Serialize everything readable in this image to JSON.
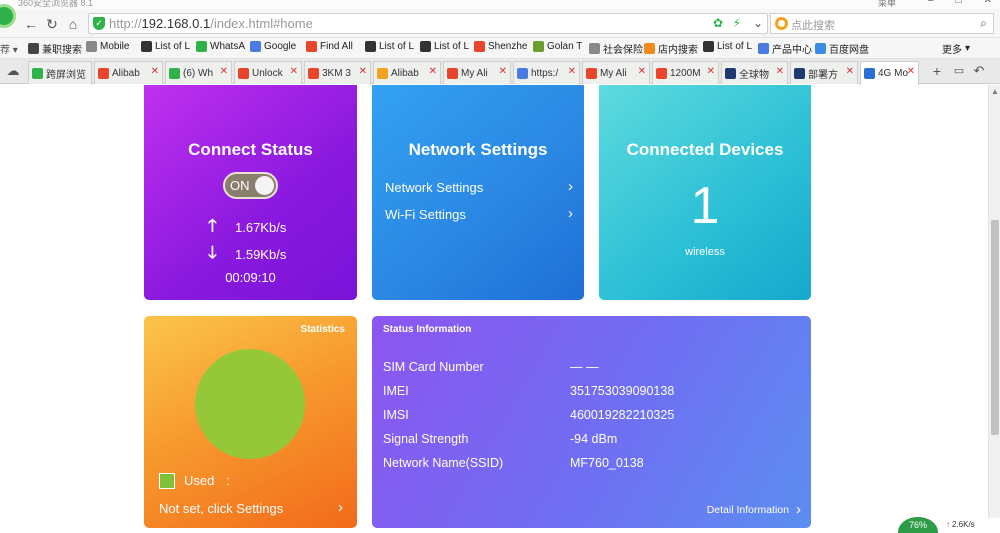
{
  "browser": {
    "app_title": "360安全浏览器 8.1",
    "skin_label": "菜单",
    "url_prefix": "http://",
    "url_host": "192.168.0.1",
    "url_path": "/index.html#home",
    "search_placeholder": "点此搜索",
    "bookmarks": [
      {
        "label": "兼职搜索",
        "icon": "ad-icon",
        "color": "#444"
      },
      {
        "label": "Mobile",
        "icon": "document-icon",
        "color": "#888"
      },
      {
        "label": "List of L",
        "icon": "wikipedia-icon",
        "color": "#333"
      },
      {
        "label": "WhatsA",
        "icon": "whatsapp-icon",
        "color": "#2fb24a"
      },
      {
        "label": "Google",
        "icon": "translate-icon",
        "color": "#4a7be0"
      },
      {
        "label": "Find All",
        "icon": "aliexpress-icon",
        "color": "#e8452c"
      },
      {
        "label": "List of L",
        "icon": "wikipedia-icon",
        "color": "#333"
      },
      {
        "label": "List of L",
        "icon": "wikipedia-icon",
        "color": "#333"
      },
      {
        "label": "Shenzhe",
        "icon": "aliexpress-icon",
        "color": "#e8452c"
      },
      {
        "label": "Golan T",
        "icon": "flag-icon",
        "color": "#6a9e2e"
      },
      {
        "label": "社会保险",
        "icon": "document-icon",
        "color": "#888"
      },
      {
        "label": "店内搜索",
        "icon": "store-icon",
        "color": "#f28a1c"
      },
      {
        "label": "List of L",
        "icon": "wikipedia-icon",
        "color": "#333"
      },
      {
        "label": "产品中心",
        "icon": "product-icon",
        "color": "#4a7be0"
      },
      {
        "label": "百度网盘",
        "icon": "cloud-icon",
        "color": "#3a8ee6"
      }
    ],
    "bookmarks_more": "更多",
    "tabs": [
      {
        "label": "跨屏浏览",
        "icon": "phone-icon",
        "color": "#2fb24a"
      },
      {
        "label": "Alibab",
        "icon": "aliexpress-icon",
        "color": "#e8452c"
      },
      {
        "label": "(6) Wh",
        "icon": "whatsapp-icon",
        "color": "#2fb24a"
      },
      {
        "label": "Unlock",
        "icon": "aliexpress-icon",
        "color": "#e8452c"
      },
      {
        "label": "3KM 3",
        "icon": "aliexpress-icon",
        "color": "#e8452c"
      },
      {
        "label": "Alibab",
        "icon": "alibaba-icon",
        "color": "#f2a21b"
      },
      {
        "label": "My Ali",
        "icon": "aliexpress-icon",
        "color": "#e8452c"
      },
      {
        "label": "https:/",
        "icon": "translate-icon",
        "color": "#4a7be0"
      },
      {
        "label": "My Ali",
        "icon": "aliexpress-icon",
        "color": "#e8452c"
      },
      {
        "label": "1200M",
        "icon": "aliexpress-icon",
        "color": "#e8452c"
      },
      {
        "label": "全球物",
        "icon": "seventeen-icon",
        "color": "#1e3a6e"
      },
      {
        "label": "部署方",
        "icon": "t-icon",
        "color": "#1e3a6e"
      },
      {
        "label": "4G Mo",
        "icon": "globe-icon",
        "color": "#2a6fd6"
      }
    ]
  },
  "connect_status": {
    "title": "Connect Status",
    "toggle_label": "ON",
    "upload_rate": "1.67Kb/s",
    "download_rate": "1.59Kb/s",
    "uptime": "00:09:10"
  },
  "network_settings": {
    "title": "Network Settings",
    "link_network": "Network Settings",
    "link_wifi": "Wi-Fi Settings"
  },
  "connected_devices": {
    "title": "Connected Devices",
    "count": "1",
    "sub_label": "wireless"
  },
  "statistics": {
    "title": "Statistics",
    "used_label": "Used",
    "used_sep": ":",
    "used_color": "#7fc13b",
    "pie_color": "#95c838",
    "settings_link": "Not set, click Settings"
  },
  "status_information": {
    "title": "Status Information",
    "rows": [
      {
        "label": "SIM Card Number",
        "value": "— —"
      },
      {
        "label": "IMEI",
        "value": "351753039090138"
      },
      {
        "label": "IMSI",
        "value": "460019282210325"
      },
      {
        "label": "Signal Strength",
        "value": "-94 dBm"
      },
      {
        "label": "Network Name(SSID)",
        "value": "MF760_0138"
      }
    ],
    "detail_link": "Detail Information"
  },
  "status_bar": {
    "percent": "76%",
    "speed": "2.6K/s"
  }
}
